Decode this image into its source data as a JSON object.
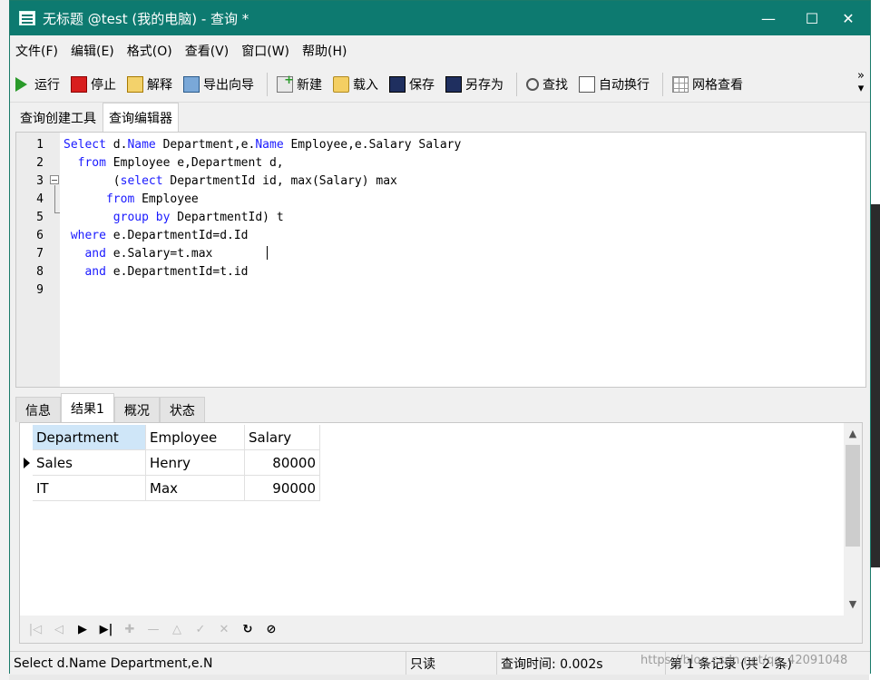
{
  "window": {
    "title": "无标题 @test (我的电脑) - 查询 *",
    "minimize": "—",
    "maximize": "☐",
    "close": "✕"
  },
  "menu": [
    "文件(F)",
    "编辑(E)",
    "格式(O)",
    "查看(V)",
    "窗口(W)",
    "帮助(H)"
  ],
  "toolbar": {
    "run": "运行",
    "stop": "停止",
    "explain": "解释",
    "export": "导出向导",
    "new": "新建",
    "load": "载入",
    "save": "保存",
    "saveas": "另存为",
    "find": "查找",
    "wrap": "自动换行",
    "grid": "网格查看",
    "more": "»"
  },
  "editor_tabs": [
    "查询创建工具",
    "查询编辑器"
  ],
  "editor": {
    "line_numbers": [
      "1",
      "2",
      "3",
      "4",
      "5",
      "6",
      "7",
      "8",
      "9"
    ],
    "lines": [
      [
        {
          "t": "Select",
          "k": true
        },
        {
          "t": " d."
        },
        {
          "t": "Name",
          "k": true
        },
        {
          "t": " Department,e."
        },
        {
          "t": "Name",
          "k": true
        },
        {
          "t": " Employee,e.Salary Salary"
        }
      ],
      [
        {
          "t": "  "
        },
        {
          "t": "from",
          "k": true
        },
        {
          "t": " Employee e,Department d,"
        }
      ],
      [
        {
          "t": "       ("
        },
        {
          "t": "select",
          "k": true
        },
        {
          "t": " DepartmentId id, max(Salary) max"
        }
      ],
      [
        {
          "t": "      "
        },
        {
          "t": "from",
          "k": true
        },
        {
          "t": " Employee"
        }
      ],
      [
        {
          "t": "       "
        },
        {
          "t": "group by",
          "k": true
        },
        {
          "t": " DepartmentId) t"
        }
      ],
      [
        {
          "t": " "
        },
        {
          "t": "where",
          "k": true
        },
        {
          "t": " e.DepartmentId=d.Id"
        }
      ],
      [
        {
          "t": "   "
        },
        {
          "t": "and",
          "k": true
        },
        {
          "t": " e.Salary=t.max"
        }
      ],
      [
        {
          "t": "   "
        },
        {
          "t": "and",
          "k": true
        },
        {
          "t": " e.DepartmentId=t.id"
        }
      ],
      []
    ],
    "keyword_color": "#1a1aff"
  },
  "result_tabs": [
    "信息",
    "结果1",
    "概况",
    "状态"
  ],
  "result": {
    "columns": [
      "Department",
      "Employee",
      "Salary"
    ],
    "rows": [
      [
        "Sales",
        "Henry",
        "80000"
      ],
      [
        "IT",
        "Max",
        "90000"
      ]
    ]
  },
  "nav_buttons": [
    {
      "name": "first-record-icon",
      "glyph": "|◁",
      "on": false
    },
    {
      "name": "prev-record-icon",
      "glyph": "◁",
      "on": false
    },
    {
      "name": "next-record-icon",
      "glyph": "▶",
      "on": true
    },
    {
      "name": "last-record-icon",
      "glyph": "▶|",
      "on": true
    },
    {
      "name": "add-record-icon",
      "glyph": "✚",
      "on": false
    },
    {
      "name": "delete-record-icon",
      "glyph": "—",
      "on": false
    },
    {
      "name": "edit-record-icon",
      "glyph": "△",
      "on": false
    },
    {
      "name": "apply-record-icon",
      "glyph": "✓",
      "on": false
    },
    {
      "name": "cancel-record-icon",
      "glyph": "✕",
      "on": false
    },
    {
      "name": "refresh-icon",
      "glyph": "↻",
      "on": true
    },
    {
      "name": "stop-refresh-icon",
      "glyph": "⊘",
      "on": true
    }
  ],
  "status": {
    "sql": "Select d.Name Department,e.N",
    "readonly": "只读",
    "time": "查询时间: 0.002s",
    "records": "第 1 条记录 (共 2 条)"
  },
  "watermark": "https://blog.csdn.net/qq_42091048"
}
